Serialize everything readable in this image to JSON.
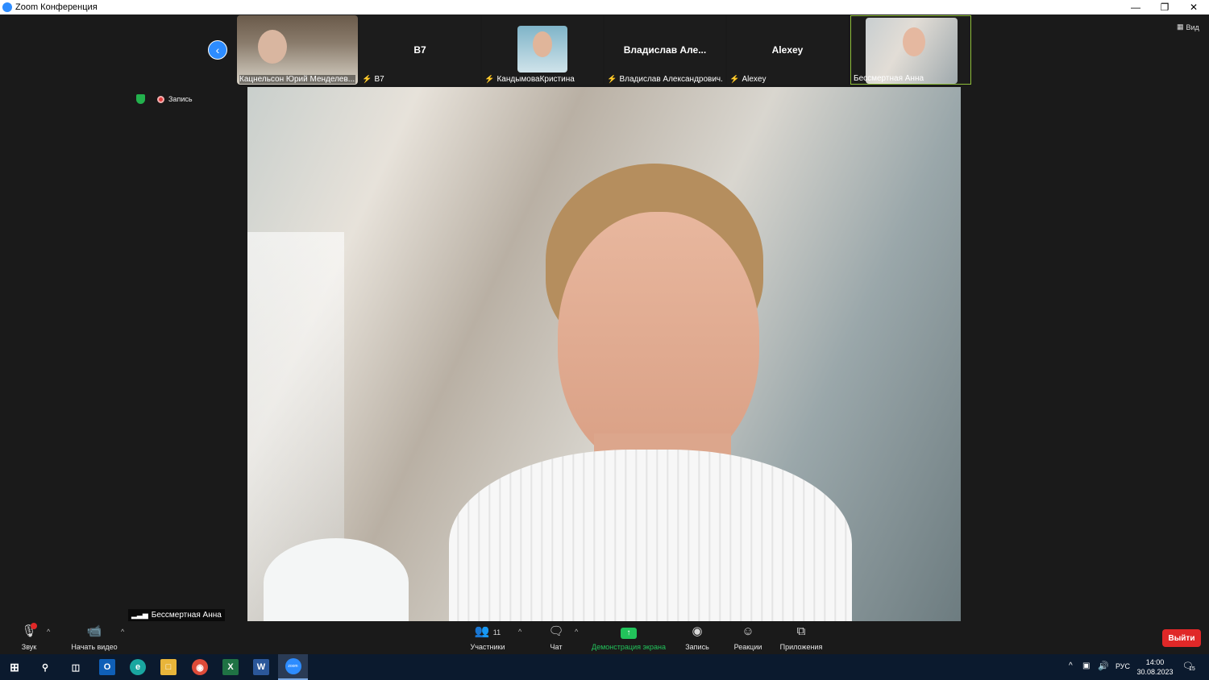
{
  "window": {
    "title": "Zoom Конференция"
  },
  "top_right": {
    "view_label": "Вид"
  },
  "status": {
    "recording_label": "Запись"
  },
  "thumbnails": [
    {
      "label": "Кацнельсон Юрий Менделев...",
      "big_name": "",
      "muted": false
    },
    {
      "label": "B7",
      "big_name": "B7",
      "muted": true
    },
    {
      "label": "КандымоваКристина",
      "big_name": "",
      "muted": true
    },
    {
      "label": "Владислав Александрович...",
      "big_name": "Владислав Але...",
      "muted": true
    },
    {
      "label": "Alexey",
      "big_name": "Alexey",
      "muted": true
    },
    {
      "label": "Бессмертная Анна",
      "big_name": "",
      "muted": false
    }
  ],
  "speaker": {
    "name": "Бессмертная Анна"
  },
  "toolbar": {
    "sound_label": "Звук",
    "video_label": "Начать видео",
    "participants_label": "Участники",
    "participants_count": "11",
    "chat_label": "Чат",
    "share_label": "Демонстрация экрана",
    "record_label": "Запись",
    "reactions_label": "Реакции",
    "apps_label": "Приложения",
    "leave_label": "Выйти"
  },
  "taskbar": {
    "lang": "РУС",
    "time": "14:00",
    "date": "30.08.2023",
    "notif_count": "15",
    "zoom_app_label": "zoom"
  },
  "colors": {
    "accent": "#2d8cff",
    "leave": "#e02828",
    "share": "#22c35b",
    "active_border": "#8fbf3a"
  }
}
